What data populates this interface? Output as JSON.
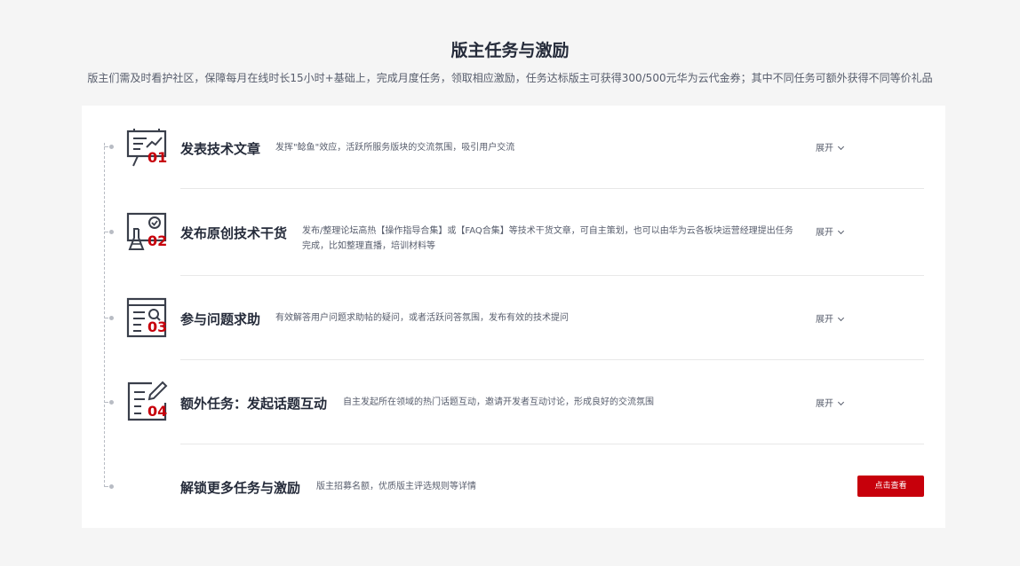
{
  "header": {
    "title": "版主任务与激励",
    "subtitle": "版主们需及时看护社区，保障每月在线时长15小时+基础上，完成月度任务，领取相应激励，任务达标版主可获得300/500元华为云代金券；其中不同任务可额外获得不同等价礼品"
  },
  "colors": {
    "accent": "#c7000b",
    "text": "#252b3a",
    "muted": "#575d6c"
  },
  "tasks": [
    {
      "number": "01",
      "icon": "presentation-board-icon",
      "title": "发表技术文章",
      "desc": "发挥\"鲶鱼\"效应，活跃所服务版块的交流氛围，吸引用户交流",
      "expand": "展开"
    },
    {
      "number": "02",
      "icon": "lab-flask-icon",
      "title": "发布原创技术干货",
      "desc": "发布/整理论坛高热【操作指导合集】或【FAQ合集】等技术干货文章，可自主策划，也可以由华为云各板块运营经理提出任务完成，比如整理直播，培训材料等",
      "expand": "展开"
    },
    {
      "number": "03",
      "icon": "document-search-icon",
      "title": "参与问题求助",
      "desc": "有效解答用户问题求助帖的疑问，或者活跃问答氛围，发布有效的技术提问",
      "expand": "展开"
    },
    {
      "number": "04",
      "icon": "document-edit-icon",
      "title": "额外任务：发起话题互动",
      "desc": "自主发起所在领域的热门话题互动，邀请开发者互动讨论，形成良好的交流氛围",
      "expand": "展开"
    }
  ],
  "more": {
    "title": "解锁更多任务与激励",
    "desc": "版主招募名额，优质版主评选规则等详情",
    "button": "点击查看"
  }
}
